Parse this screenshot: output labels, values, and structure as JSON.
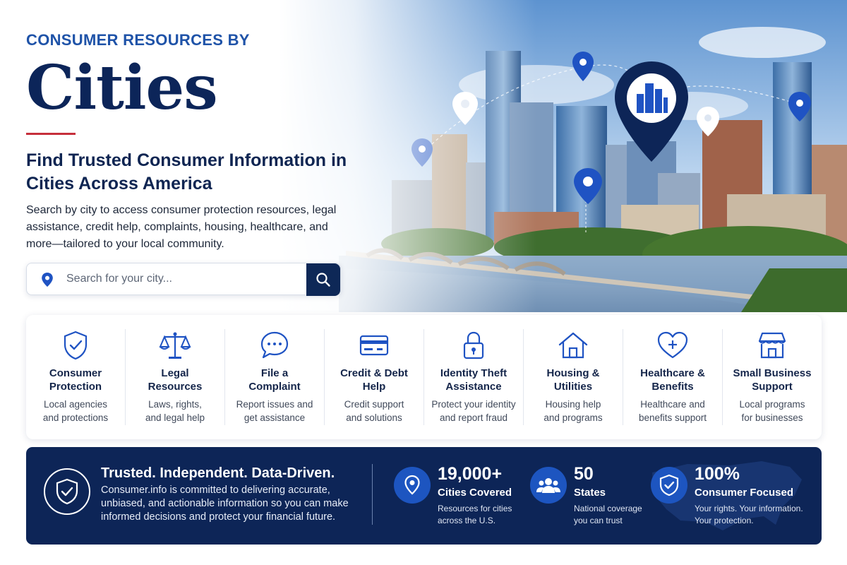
{
  "hero": {
    "eyebrow": "CONSUMER RESOURCES BY",
    "title": "Cities",
    "subheading": "Find Trusted Consumer Information in Cities Across America",
    "description": "Search by city to access consumer protection resources, legal assistance, credit help, complaints, housing, healthcare, and more—tailored to your local community."
  },
  "search": {
    "placeholder": "Search for your city...",
    "value": ""
  },
  "categories": [
    {
      "icon": "shield-check-icon",
      "title": "Consumer\nProtection",
      "desc": "Local agencies\nand protections"
    },
    {
      "icon": "scales-icon",
      "title": "Legal\nResources",
      "desc": "Laws, rights,\nand legal help"
    },
    {
      "icon": "chat-bubble-icon",
      "title": "File a\nComplaint",
      "desc": "Report issues and\nget assistance"
    },
    {
      "icon": "credit-card-icon",
      "title": "Credit & Debt\nHelp",
      "desc": "Credit support\nand solutions"
    },
    {
      "icon": "lock-icon",
      "title": "Identity Theft\nAssistance",
      "desc": "Protect your identity\nand report fraud"
    },
    {
      "icon": "house-icon",
      "title": "Housing &\nUtilities",
      "desc": "Housing help\nand programs"
    },
    {
      "icon": "heart-plus-icon",
      "title": "Healthcare &\nBenefits",
      "desc": "Healthcare and\nbenefits support"
    },
    {
      "icon": "storefront-icon",
      "title": "Small Business\nSupport",
      "desc": "Local programs\nfor businesses"
    }
  ],
  "banner": {
    "title": "Trusted. Independent. Data-Driven.",
    "text": "Consumer.info is committed to delivering accurate, unbiased, and actionable information so you can make informed decisions and protect your financial future.",
    "stats": [
      {
        "icon": "map-pin-icon",
        "number": "19,000+",
        "label": "Cities Covered",
        "sub": "Resources for cities\nacross the U.S."
      },
      {
        "icon": "people-icon",
        "number": "50",
        "label": "States",
        "sub": "National coverage\nyou can trust"
      },
      {
        "icon": "shield-check-icon",
        "number": "100%",
        "label": "Consumer Focused",
        "sub": "Your rights. Your information.\nYour protection."
      }
    ]
  },
  "colors": {
    "navy": "#0d2557",
    "brand_blue": "#1f53a8",
    "accent_red": "#c62f3b",
    "stat_blue": "#1d55c0"
  }
}
